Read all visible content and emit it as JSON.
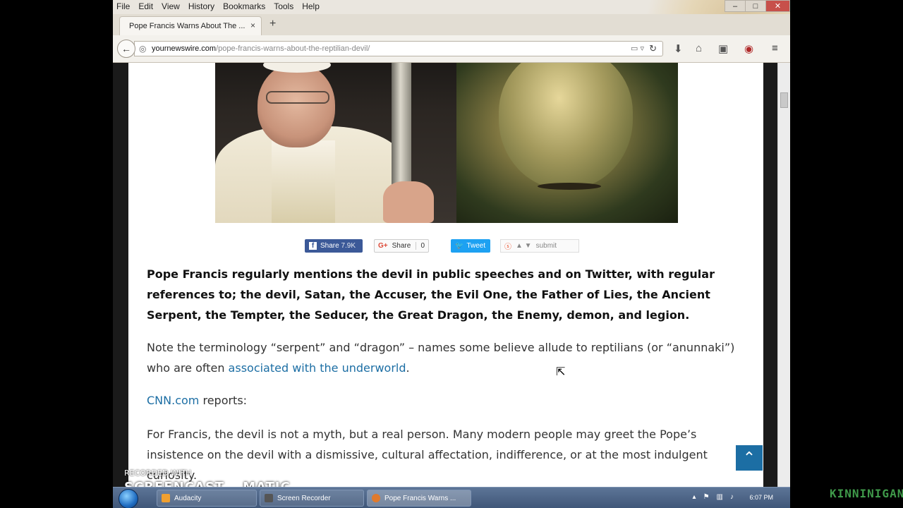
{
  "menubar": {
    "items": [
      "File",
      "Edit",
      "View",
      "History",
      "Bookmarks",
      "Tools",
      "Help"
    ]
  },
  "window_controls": {
    "minimize": "–",
    "maximize": "□",
    "close": "✕"
  },
  "tab": {
    "title": "Pope Francis Warns About The ...",
    "close": "×",
    "new_tab": "+"
  },
  "navbar": {
    "back": "←",
    "url_domain": "yournewswire.com",
    "url_path": "/pope-francis-warns-about-the-reptilian-devil/"
  },
  "share": {
    "facebook_label": "Share",
    "facebook_count": "7.9K",
    "gplus_label": "Share",
    "gplus_count": "0",
    "twitter_label": "Tweet",
    "stumble_label": "submit"
  },
  "article": {
    "p1": "Pope Francis regularly mentions the devil in public speeches and on Twitter, with regular references to; the devil, Satan, the Accuser, the Evil One, the Father of Lies, the Ancient Serpent, the Tempter, the Seducer, the Great Dragon, the Enemy, demon, and legion.",
    "p2_before": "Note the terminology “serpent” and “dragon” – names some believe allude to reptilians (or “anunnaki”) who are often ",
    "p2_link": "associated with the underworld",
    "p2_after": ".",
    "p3_link": "CNN.com",
    "p3_after": " reports:",
    "p4": "For Francis, the devil is not a myth, but a real person. Many modern people may greet the Pope’s insistence on the devil with a dismissive, cultural affectation, indifference, or at the most indulgent curiosity."
  },
  "back_to_top": "⌃",
  "watermark": {
    "recorded": "RECORDED WITH",
    "brand_a": "SCREENCAST",
    "brand_b": "MATIC"
  },
  "taskbar": {
    "tasks": [
      "Audacity",
      "Screen Recorder",
      "Pope Francis Warns ..."
    ],
    "clock": "6:07 PM"
  },
  "channel": "KINNINIGAN",
  "colors": {
    "link": "#1c6ea4",
    "facebook": "#3b5998",
    "twitter": "#1da1f2"
  }
}
